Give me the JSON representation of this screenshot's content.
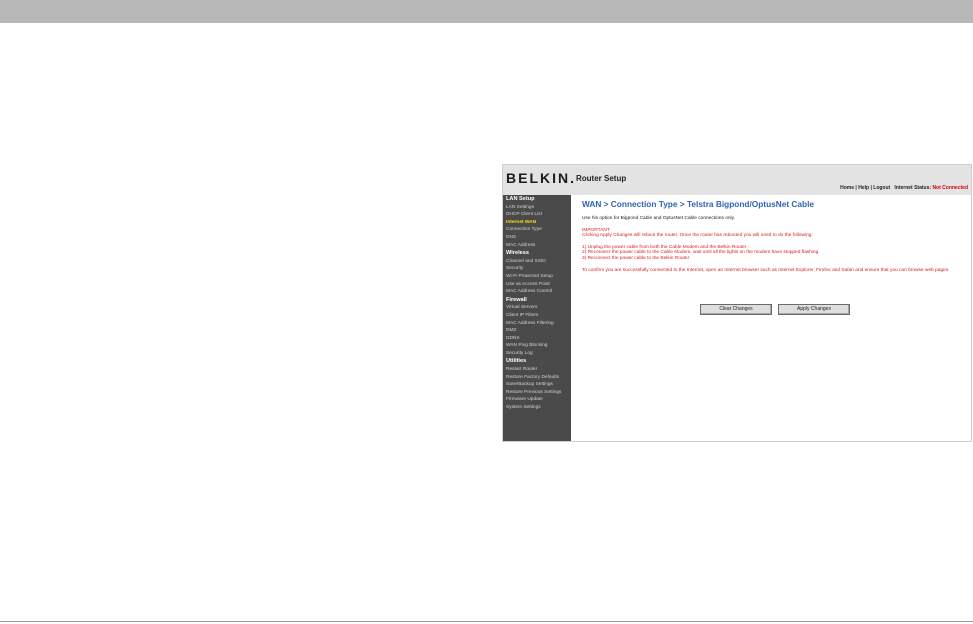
{
  "header": {
    "brand": "BELKIN.",
    "title": "Router Setup",
    "links": [
      "Home",
      "Help",
      "Logout"
    ],
    "status_label": "Internet Status:",
    "status_value": "Not Connected"
  },
  "sidebar": {
    "sections": [
      {
        "label": "LAN Setup",
        "items": [
          "LAN Settings",
          "DHCP Client List"
        ]
      },
      {
        "label": "Internet WAN",
        "items": [
          "Connection Type",
          "DNS",
          "MAC Address"
        ]
      },
      {
        "label": "Wireless",
        "items": [
          "Channel and SSID",
          "Security",
          "Wi-Fi Protected Setup",
          "Use as Access Point",
          "MAC Address Control"
        ]
      },
      {
        "label": "Firewall",
        "items": [
          "Virtual Servers",
          "Client IP Filters",
          "MAC Address Filtering",
          "DMZ",
          "DDNS",
          "WAN Ping Blocking",
          "Security Log"
        ]
      },
      {
        "label": "Utilities",
        "items": [
          "Restart Router",
          "Restore Factory Defaults",
          "Save/Backup Settings",
          "Restore Previous Settings",
          "Firmware Update",
          "System Settings"
        ]
      }
    ]
  },
  "main": {
    "title": "WAN > Connection Type > Telstra Bigpond/OptusNet Cable",
    "intro": "Use his option for Bigpond Cable and OptusNet Cable connections only.",
    "important_heading": "IMPORTANT",
    "important_text": "Clicking Apply Changes will reboot the router. Once the router has rebooted you will need to do the following:",
    "steps": [
      "1) Unplug the power cable from both the Cable Modem and the Belkin Router",
      "2) Reconnect the power cable to the Cable Modem, wait until all the lights on the modem have stopped flashing",
      "3) Reconnect the power cable to the Belkin Router"
    ],
    "confirm_text": "To confirm you are successfully connected to the Internet, open an Internet browser such as Internet Explorer, Firefox and Safari and ensure that you can browse web pages.",
    "buttons": {
      "clear": "Clear Changes",
      "apply": "Apply Changes"
    }
  }
}
